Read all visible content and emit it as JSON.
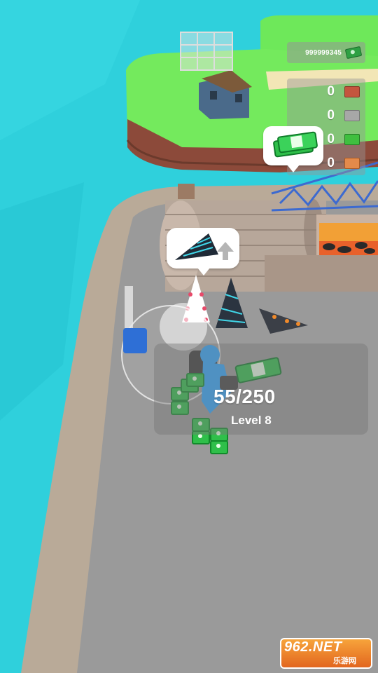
{
  "hud": {
    "money": "999999345",
    "resources": [
      {
        "count": "0",
        "icon": "red-brick-icon",
        "color": "#c4553e"
      },
      {
        "count": "0",
        "icon": "gray-brick-icon",
        "color": "#a7a7a7"
      },
      {
        "count": "0",
        "icon": "green-brick-icon",
        "color": "#3fbf3f"
      },
      {
        "count": "0",
        "icon": "orange-brick-icon",
        "color": "#e38a4b"
      }
    ]
  },
  "station": {
    "progress": "55/250",
    "level": "Level 8"
  },
  "watermark": {
    "top": "962.NET",
    "bottom": "乐游网"
  },
  "colors": {
    "water": "#2fd0dc",
    "grass": "#6ee85a",
    "floor": "#9a9a9a",
    "player": "#2ea7ff"
  }
}
